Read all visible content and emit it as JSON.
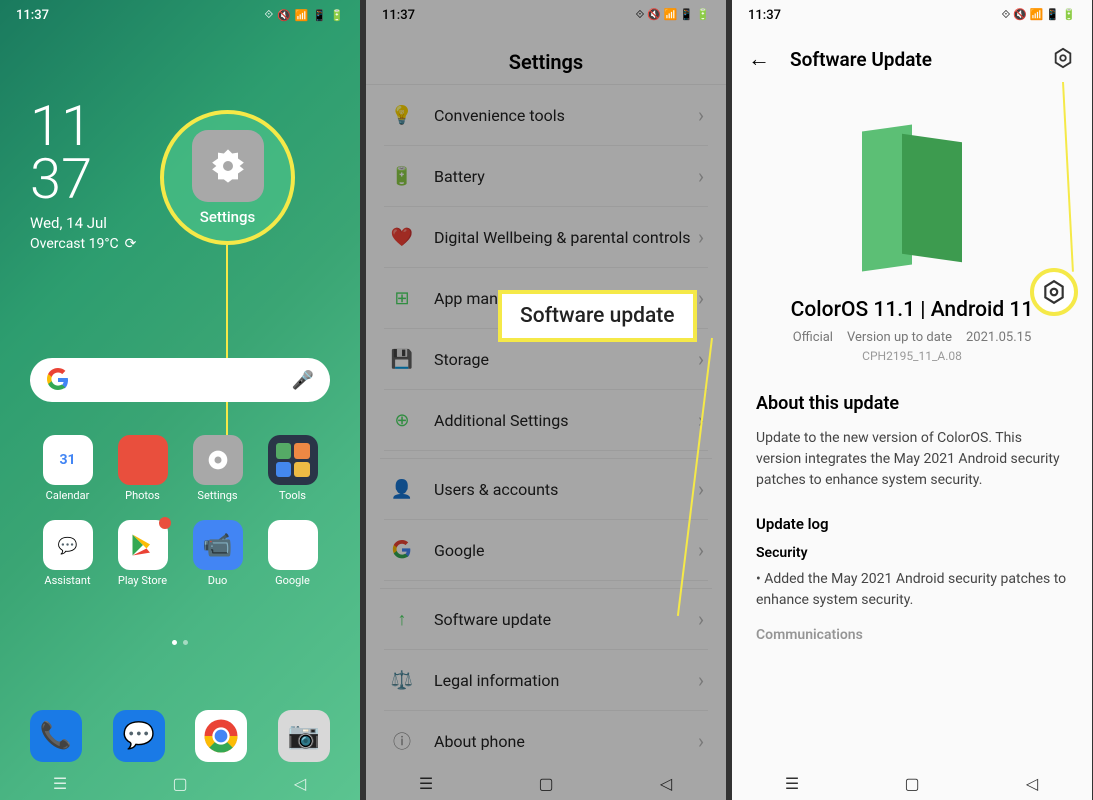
{
  "statusbar": {
    "time": "11:37"
  },
  "phone1": {
    "clock": {
      "hour": "11",
      "minute": "37",
      "date": "Wed, 14 Jul",
      "weather": "Overcast 19°C"
    },
    "highlight_label": "Settings",
    "apps": [
      {
        "label": "Calendar"
      },
      {
        "label": "Photos"
      },
      {
        "label": "Settings"
      },
      {
        "label": "Tools"
      },
      {
        "label": "Assistant"
      },
      {
        "label": "Play Store"
      },
      {
        "label": "Duo"
      },
      {
        "label": "Google"
      }
    ]
  },
  "phone2": {
    "title": "Settings",
    "items": [
      {
        "label": "Convenience tools"
      },
      {
        "label": "Battery"
      },
      {
        "label": "Digital Wellbeing & parental controls"
      },
      {
        "label": "App management"
      },
      {
        "label": "Storage"
      },
      {
        "label": "Additional Settings"
      },
      {
        "label": "Users & accounts"
      },
      {
        "label": "Google"
      },
      {
        "label": "Software update"
      },
      {
        "label": "Legal information"
      },
      {
        "label": "About phone"
      }
    ],
    "highlight": "Software update"
  },
  "phone3": {
    "title": "Software Update",
    "version": "ColorOS 11.1 | Android 11",
    "meta": {
      "channel": "Official",
      "status": "Version up to date",
      "date": "2021.05.15"
    },
    "build": "CPH2195_11_A.08",
    "about_title": "About this update",
    "about_text": "Update to the new version of ColorOS. This version integrates the May 2021 Android security patches to enhance system security.",
    "log_title": "Update log",
    "security_title": "Security",
    "security_item": "• Added the May 2021 Android security patches to enhance system security.",
    "comm_title": "Communications"
  }
}
